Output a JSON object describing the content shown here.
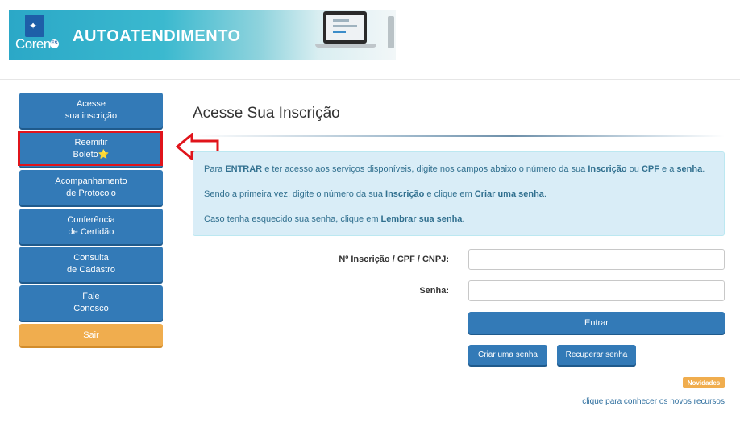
{
  "header": {
    "logo_text": "Coren",
    "logo_badge": "ES",
    "title": "AUTOATENDIMENTO"
  },
  "sidebar": {
    "items": [
      {
        "label": "Acesse\nsua inscrição"
      },
      {
        "label": "Reemitir\nBoleto⭐"
      },
      {
        "label": "Acompanhamento\nde Protocolo"
      },
      {
        "label": "Conferência\nde Certidão"
      },
      {
        "label": "Consulta\nde Cadastro"
      },
      {
        "label": "Fale\nConosco"
      },
      {
        "label": "Sair"
      }
    ]
  },
  "main": {
    "title": "Acesse Sua Inscrição",
    "info": {
      "line1": {
        "p1": "Para ",
        "b1": "ENTRAR",
        "p2": " e ter acesso aos serviços disponíveis, digite nos campos abaixo o número da sua ",
        "b2": "Inscrição",
        "p3": " ou ",
        "b3": "CPF",
        "p4": " e a ",
        "b4": "senha",
        "p5": "."
      },
      "line2": {
        "p1": "Sendo a primeira vez, digite o número da sua ",
        "b1": "Inscrição",
        "p2": " e clique em ",
        "b2": "Criar uma senha",
        "p3": "."
      },
      "line3": {
        "p1": "Caso tenha esquecido sua senha, clique em ",
        "b1": "Lembrar sua senha",
        "p2": "."
      }
    },
    "form": {
      "inscricao_label": "Nº Inscrição / CPF / CNPJ:",
      "inscricao_value": "",
      "senha_label": "Senha:",
      "senha_value": "",
      "entrar_label": "Entrar",
      "criar_label": "Criar uma senha",
      "recuperar_label": "Recuperar senha"
    },
    "novidades_badge": "Novidades",
    "novidades_link": "clique para conhecer os novos recursos"
  },
  "colors": {
    "primary": "#337ab7",
    "warning": "#f0ad4e",
    "highlight": "#e0141b",
    "info_bg": "#d9edf7"
  },
  "icons": [
    "coren-logo-icon",
    "star-icon",
    "left-arrow-icon"
  ]
}
